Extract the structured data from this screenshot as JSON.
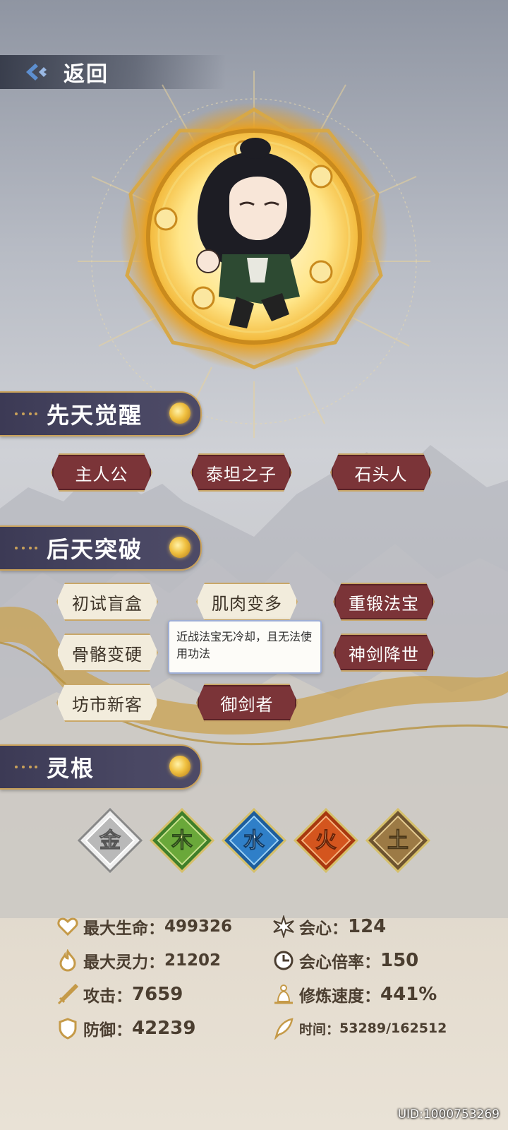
{
  "nav": {
    "back_label": "返回"
  },
  "innate": {
    "title": "先天觉醒",
    "tags": [
      "主人公",
      "泰坦之子",
      "石头人"
    ]
  },
  "acquired": {
    "title": "后天突破",
    "tags": [
      "初试盲盒",
      "肌肉变多",
      "重锻法宝",
      "骨骼变硬",
      "神剑降世",
      "坊市新客",
      "御剑者"
    ],
    "tooltip": "近战法宝无冷却，且无法使用功法"
  },
  "spirit_root": {
    "title": "灵根",
    "elements": [
      {
        "name": "金",
        "color": "#b9b9b9"
      },
      {
        "name": "木",
        "color": "#6aa83a"
      },
      {
        "name": "水",
        "color": "#2f7fc8"
      },
      {
        "name": "火",
        "color": "#d4551e"
      },
      {
        "name": "土",
        "color": "#9c7a45"
      }
    ]
  },
  "stats": {
    "max_hp": {
      "label": "最大生命：",
      "value": "499326"
    },
    "crit": {
      "label": "会心：",
      "value": "124"
    },
    "max_mp": {
      "label": "最大灵力：",
      "value": "21202"
    },
    "crit_mult": {
      "label": "会心倍率：",
      "value": "150"
    },
    "attack": {
      "label": "攻击：",
      "value": "7659"
    },
    "cultivation_speed": {
      "label": "修炼速度：",
      "value": "441%"
    },
    "defense": {
      "label": "防御：",
      "value": "42239"
    },
    "time": {
      "label": "时间：",
      "value": "53289/162512"
    }
  },
  "uid": "UID:1000753269"
}
